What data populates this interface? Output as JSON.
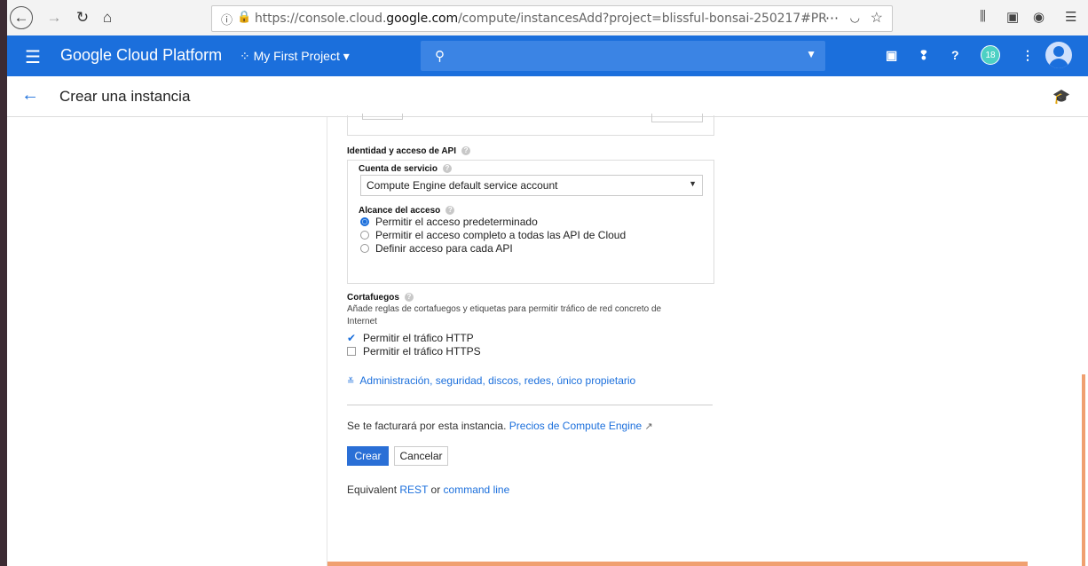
{
  "browser": {
    "url_prefix": "https://console.cloud.",
    "url_domain": "google.com",
    "url_suffix": "/compute/instancesAdd?project=blissful-bonsai-250217#PR",
    "more_icon": "⋯"
  },
  "gcp_header": {
    "brand": "Google Cloud Platform",
    "project": "My First Project",
    "notification_count": "18"
  },
  "page": {
    "title": "Crear una instancia"
  },
  "identity": {
    "section_title": "Identidad y acceso de API",
    "service_account_label": "Cuenta de servicio",
    "service_account_value": "Compute Engine default service account",
    "scope_label": "Alcance del acceso",
    "scope_options": [
      "Permitir el acceso predeterminado",
      "Permitir el acceso completo a todas las API de Cloud",
      "Definir acceso para cada API"
    ]
  },
  "firewall": {
    "section_title": "Cortafuegos",
    "description": "Añade reglas de cortafuegos y etiquetas para permitir tráfico de red concreto de Internet",
    "http_label": "Permitir el tráfico HTTP",
    "https_label": "Permitir el tráfico HTTPS"
  },
  "advanced_link": "Administración, seguridad, discos, redes, único propietario",
  "billing": {
    "text": "Se te facturará por esta instancia.",
    "link": "Precios de Compute Engine"
  },
  "buttons": {
    "create": "Crear",
    "cancel": "Cancelar"
  },
  "equivalent": {
    "prefix": "Equivalent",
    "rest": "REST",
    "or": "or",
    "command_line": "command line"
  },
  "colors": {
    "gcp_blue": "#1b6fdc",
    "primary_button": "#2a6fd6",
    "link": "#1b6fdc"
  }
}
